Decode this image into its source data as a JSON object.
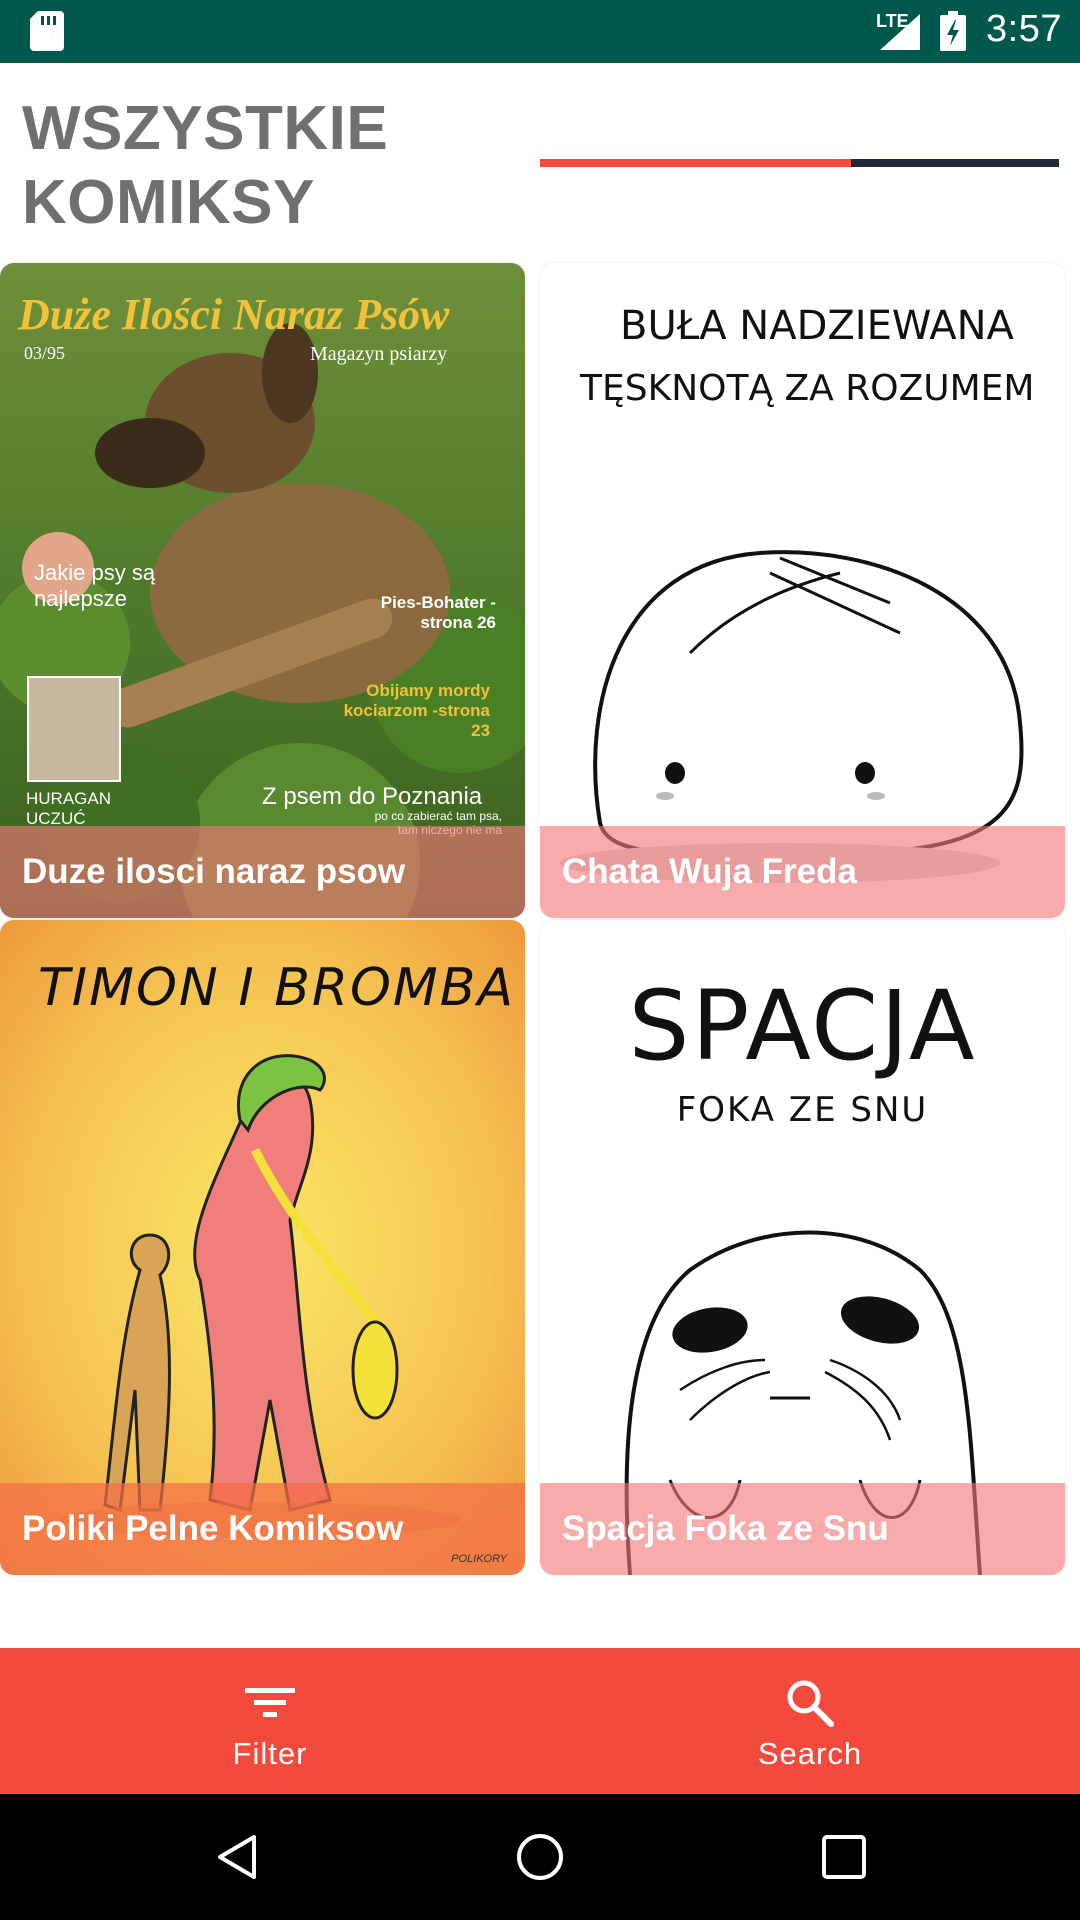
{
  "status_bar": {
    "network": "LTE",
    "time": "3:57"
  },
  "header": {
    "title": "WSZYSTKIE\nKOMIKSY",
    "progress": 0.6
  },
  "comics": [
    {
      "title": "Duze ilosci naraz psow",
      "cover_text": {
        "headline": "Duże Ilości Naraz Psów",
        "issue": "03/95",
        "magazine": "Magazyn psiarzy",
        "blurb1": "Jakie psy są najlepsze",
        "blurb2": "Pies-Bohater -strona 26",
        "blurb3": "Obijamy mordy kociarzom -strona 23",
        "blurb4": "HURAGAN UCZUĆ",
        "blurb5": "Z psem do Poznania",
        "blurb6": "po co zabierać tam psa, tam niczego nie ma"
      }
    },
    {
      "title": "Chata Wuja Freda",
      "cover_text": {
        "line1": "BUŁA NADZIEWANA",
        "line2": "TĘSKNOTĄ ZA ROZUMEM"
      }
    },
    {
      "title": "Poliki Pelne Komiksow",
      "cover_text": {
        "line1": "TIMON I BROMBA",
        "signature": "POLIKORY"
      }
    },
    {
      "title": "Spacja Foka ze Snu",
      "cover_text": {
        "line1": "SPACJA",
        "line2": "FOKA ZE SNU"
      }
    }
  ],
  "bottom_nav": {
    "filter_label": "Filter",
    "search_label": "Search"
  },
  "colors": {
    "status_bar": "#00574b",
    "accent": "#f44a3d",
    "track": "#1f2a36",
    "title_gray": "#707070"
  }
}
